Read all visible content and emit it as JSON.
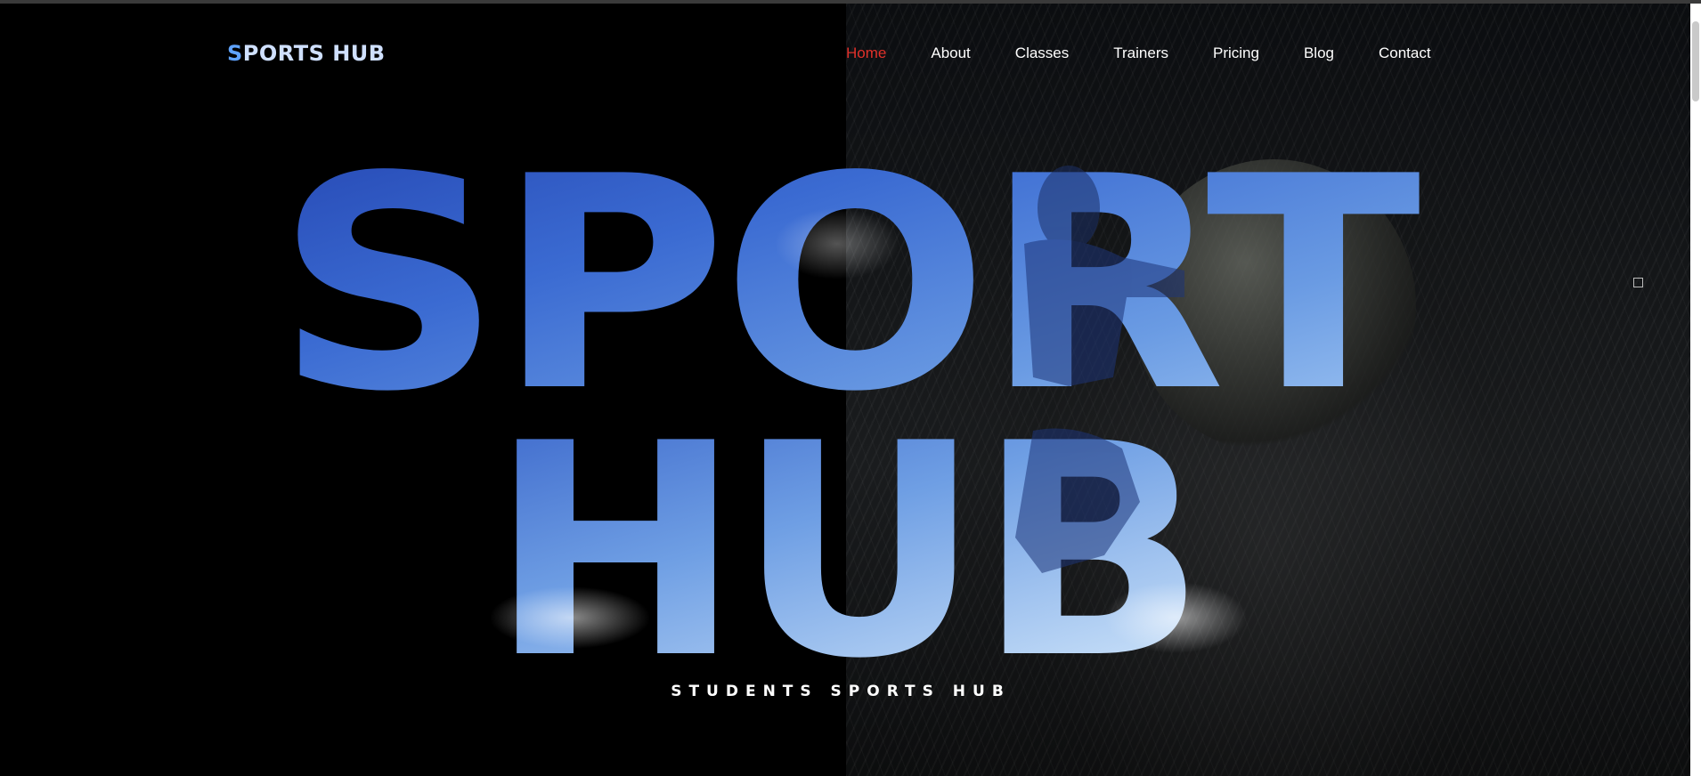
{
  "brand": {
    "first_letter": "S",
    "rest": "PORTS HUB"
  },
  "nav": {
    "items": [
      {
        "label": "Home",
        "active": true
      },
      {
        "label": "About",
        "active": false
      },
      {
        "label": "Classes",
        "active": false
      },
      {
        "label": "Trainers",
        "active": false
      },
      {
        "label": "Pricing",
        "active": false
      },
      {
        "label": "Blog",
        "active": false
      },
      {
        "label": "Contact",
        "active": false
      }
    ]
  },
  "hero": {
    "line1": "SPORT",
    "line2": "HUB",
    "tagline": "STUDENTS SPORTS HUB"
  },
  "colors": {
    "accent_active": "#e0312a",
    "hero_blue_dark": "#2a4fb8",
    "hero_blue_light": "#9cc4f2",
    "logo_blue": "#5fa3ff"
  }
}
